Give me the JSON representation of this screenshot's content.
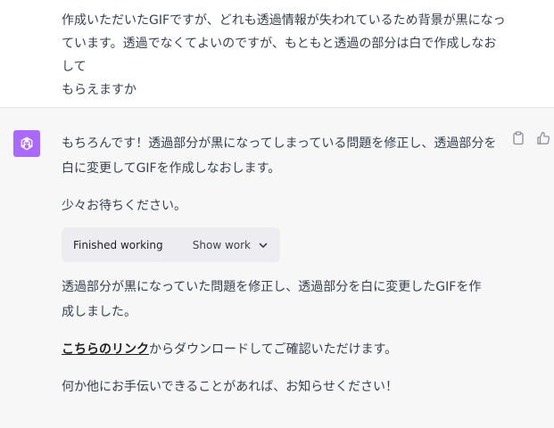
{
  "user_message": {
    "lines": [
      "作成いただいたGIFですが、どれも透過情報が失われているため背景が黒になっ",
      "ています。透過でなくてよいのですが、もともと透過の部分は白で作成しなおして",
      "もらえますか"
    ]
  },
  "assistant": {
    "avatar_icon": "openai-logo-icon",
    "avatar_color": "#ab68ff",
    "actions": {
      "copy_icon": "clipboard-icon",
      "like_icon": "thumbs-up-icon"
    },
    "para1": [
      "もちろんです！透過部分が黒になってしまっている問題を修正し、透過部分を",
      "白に変更してGIFを作成しなおします。"
    ],
    "para2": "少々お待ちください。",
    "work": {
      "status": "Finished working",
      "toggle_label": "Show work",
      "toggle_icon": "chevron-down-icon"
    },
    "para3": [
      "透過部分が黒になっていた問題を修正し、透過部分を白に変更したGIFを作",
      "成しました。"
    ],
    "para4": {
      "link_text": "こちらのリンク",
      "rest": "からダウンロードしてご確認いただけます。"
    },
    "para5": "何か他にお手伝いできることがあれば、お知らせください！"
  },
  "colors": {
    "assistant_bg": "#f7f7f8",
    "work_box_bg": "#ececf1",
    "text": "#374151"
  }
}
